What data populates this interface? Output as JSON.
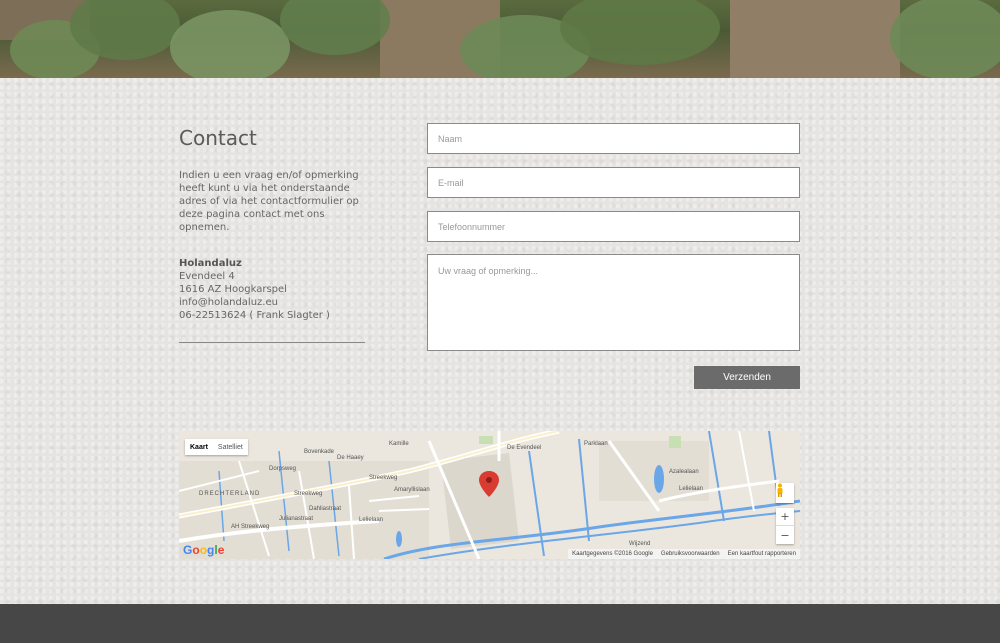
{
  "contact": {
    "title": "Contact",
    "intro": "Indien u een vraag en/of opmerking heeft kunt u via het onderstaande adres of via het contactformulier op deze pagina contact met ons opnemen.",
    "company": "Holandaluz",
    "street": "Evendeel 4",
    "postal_city": "1616 AZ Hoogkarspel",
    "email": "info@holandaluz.eu",
    "phone": "06-22513624 ( Frank Slagter )"
  },
  "form": {
    "name_placeholder": "Naam",
    "email_placeholder": "E-mail",
    "phone_placeholder": "Telefoonnummer",
    "message_placeholder": "Uw vraag of opmerking...",
    "submit_label": "Verzenden"
  },
  "map": {
    "type_map": "Kaart",
    "type_satellite": "Satelliet",
    "zoom_in": "+",
    "zoom_out": "−",
    "logo": "Google",
    "attribution": "Kaartgegevens ©2016 Google",
    "terms": "Gebruiksvoorwaarden",
    "report": "Een kaartfout rapporteren",
    "labels": {
      "streekweg": "Streekweg",
      "streekweg2": "Streekweg",
      "drechterland": "DRECHTERLAND",
      "boveneind": "Bovenkade",
      "de_haaey": "De Haaey",
      "kamille": "Kamille",
      "amaryllislaan": "Amaryllislaan",
      "lelielaan": "Lelielaan",
      "de_evendeel": "De Evendeel",
      "ah_streekweg": "AH Streekweg",
      "azalealaan": "Azalealaan",
      "lelielaan2": "Lelielaan",
      "wijzend": "Wijzend",
      "parklaan": "Parklaan",
      "dahliastraat": "Dahliastraat",
      "julianastraat": "Julianastraat",
      "dorpsweg": "Dorpsweg"
    },
    "colors": {
      "water": "#6aa6e8",
      "road": "#ffffff",
      "land": "#ebe7df",
      "marker": "#d93b30"
    }
  }
}
